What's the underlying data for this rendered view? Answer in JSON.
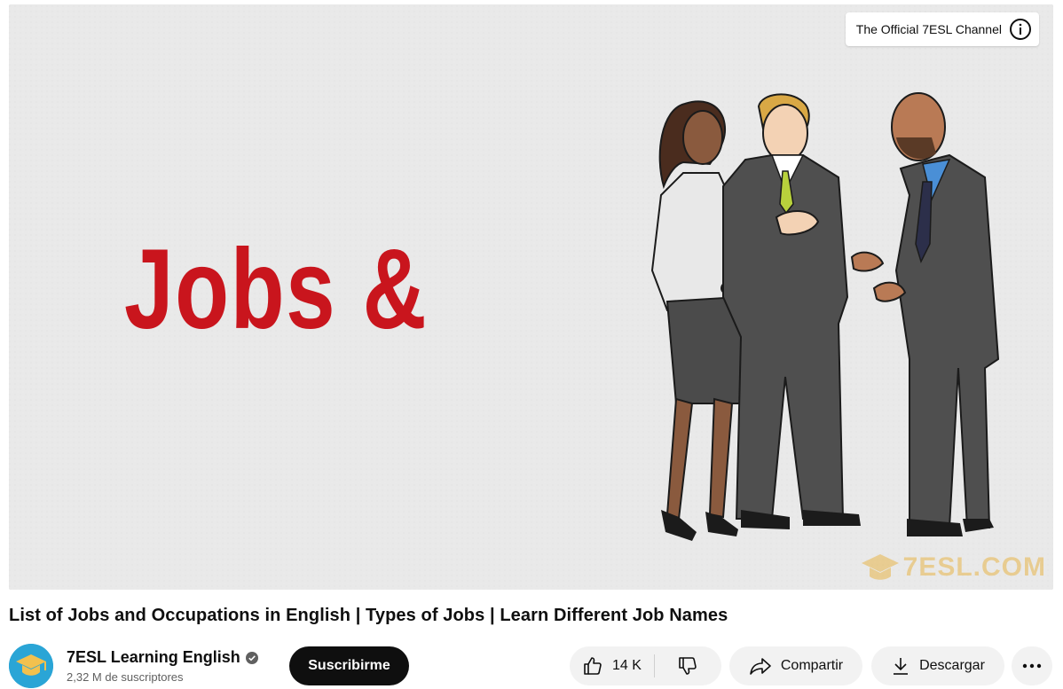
{
  "player": {
    "headline": "Jobs &",
    "card_chip_text": "The Official 7ESL Channel",
    "watermark_text": "7ESL.COM",
    "background_color": "#e9e9e9",
    "headline_color": "#c9151d"
  },
  "video": {
    "title": "List of Jobs and Occupations in English | Types of Jobs | Learn Different Job Names"
  },
  "channel": {
    "name": "7ESL Learning English",
    "subscribers": "2,32 M de suscriptores",
    "subscribe_label": "Suscribirme",
    "avatar_color": "#2aa5d6",
    "verified_icon": "check-circle-icon"
  },
  "actions": {
    "like_count": "14 K",
    "share_label": "Compartir",
    "download_label": "Descargar",
    "icons": {
      "like": "thumbs-up-icon",
      "dislike": "thumbs-down-icon",
      "share": "share-arrow-icon",
      "download": "download-icon",
      "more": "more-horizontal-icon",
      "info": "info-icon"
    }
  }
}
